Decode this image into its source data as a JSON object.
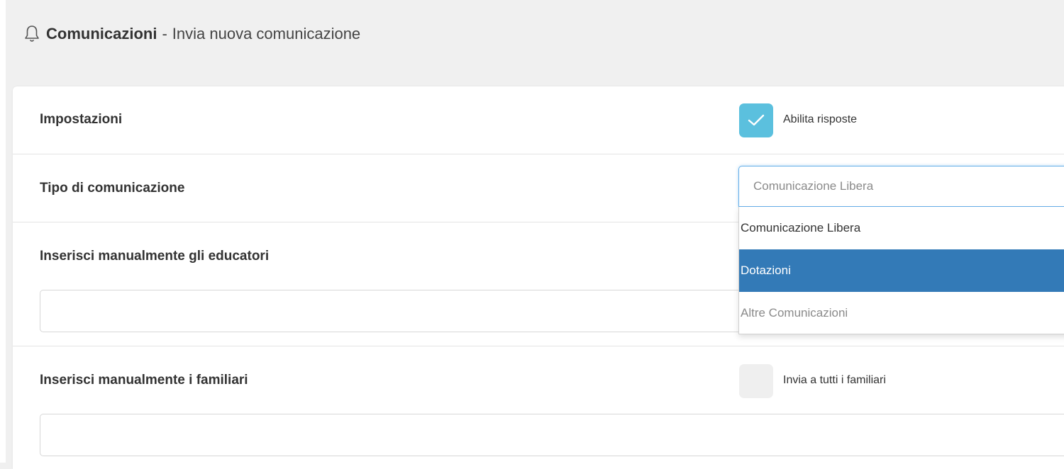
{
  "header": {
    "section": "Comunicazioni",
    "separator": "-",
    "subtitle": "Invia nuova comunicazione",
    "icon": "bell-icon"
  },
  "settings": {
    "label": "Impostazioni",
    "enable_replies": {
      "label": "Abilita risposte",
      "checked": true
    }
  },
  "communication_type": {
    "label": "Tipo di comunicazione",
    "selected_value": "Comunicazione Libera",
    "options": [
      {
        "label": "Comunicazione Libera",
        "state": "normal"
      },
      {
        "label": "Dotazioni",
        "state": "highlighted"
      },
      {
        "label": "Altre Comunicazioni",
        "state": "muted"
      }
    ]
  },
  "educators": {
    "label": "Inserisci manualmente gli educatori",
    "value": ""
  },
  "families": {
    "label": "Inserisci manualmente i familiari",
    "send_all": {
      "label": "Invia a tutti i familiari",
      "checked": false
    },
    "value": ""
  },
  "colors": {
    "accent_checkbox": "#5bc0de",
    "selected_option": "#337ab7",
    "background": "#f0f0f0"
  }
}
